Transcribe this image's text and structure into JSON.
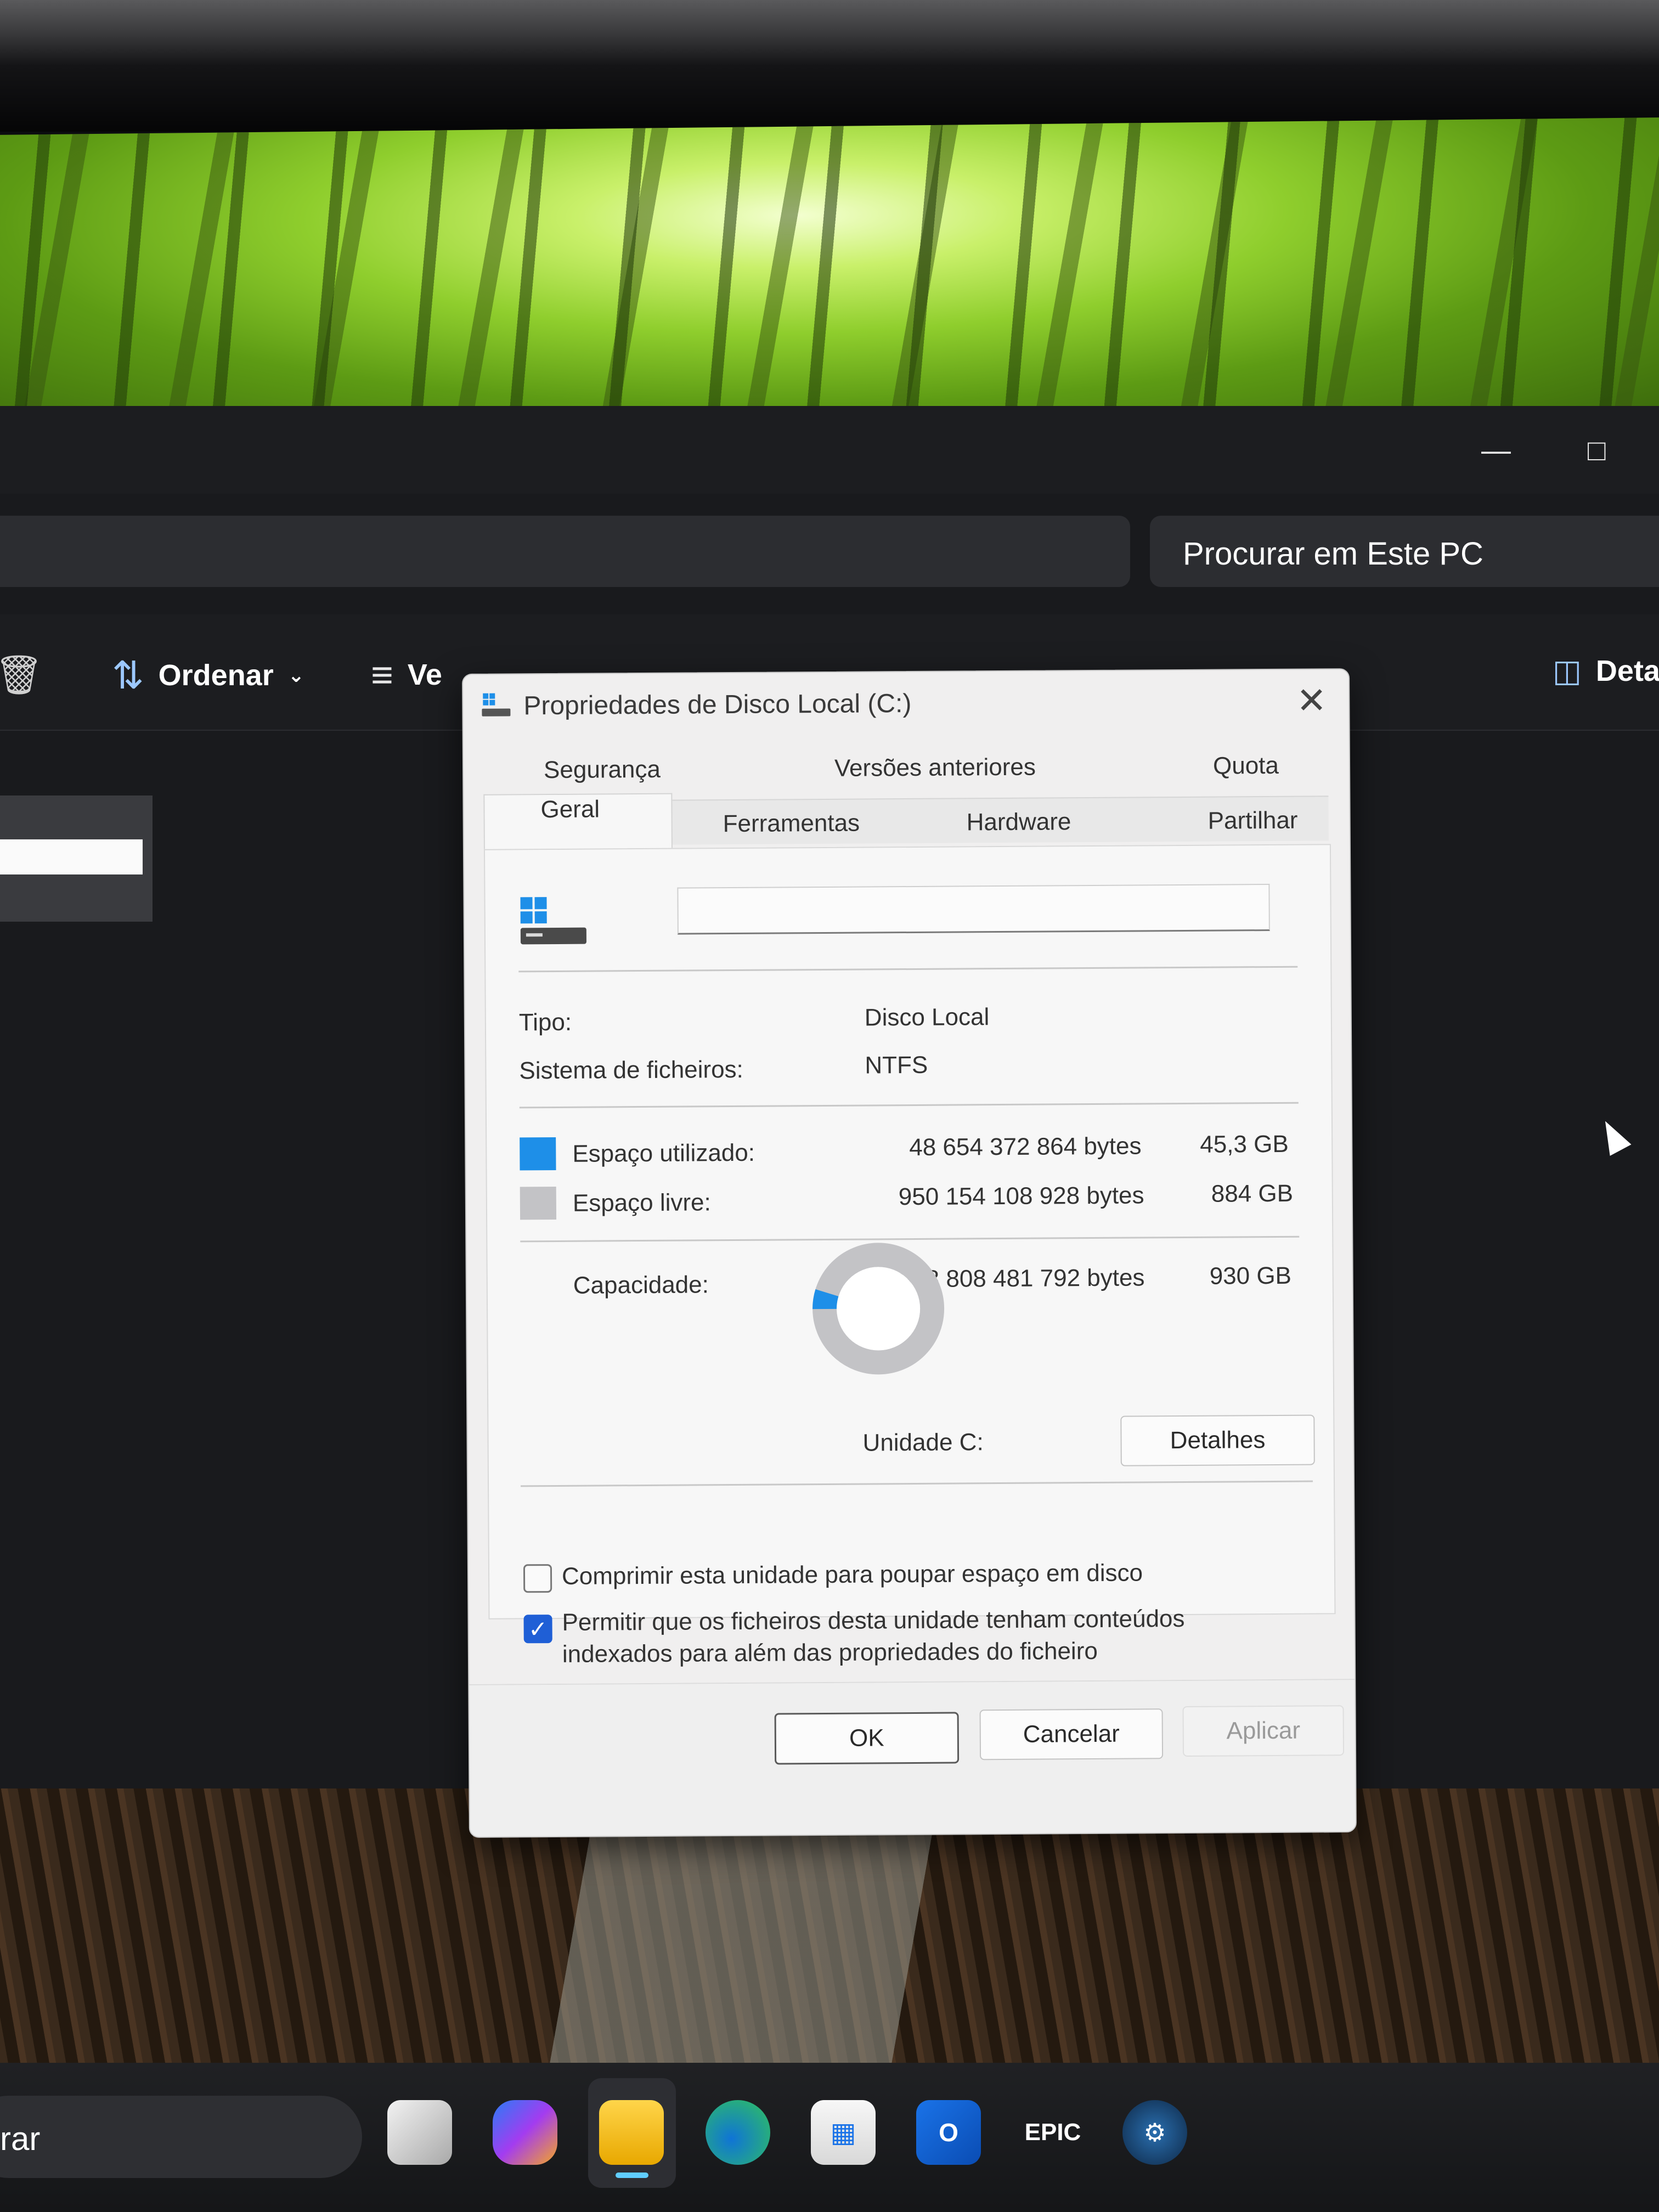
{
  "explorer": {
    "search_placeholder": "Procurar em Este PC",
    "toolbar": {
      "sort_label": "Ordenar",
      "view_label": "Ve",
      "details_label": "Deta"
    }
  },
  "dialog": {
    "title": "Propriedades de Disco Local (C:)",
    "tabs_row1": [
      "Segurança",
      "Versões anteriores",
      "Quota"
    ],
    "tabs_row2": [
      "Geral",
      "Ferramentas",
      "Hardware",
      "Partilhar"
    ],
    "active_tab": "Geral",
    "name_value": "",
    "type_label": "Tipo:",
    "type_value": "Disco Local",
    "fs_label": "Sistema de ficheiros:",
    "fs_value": "NTFS",
    "used_label": "Espaço utilizado:",
    "used_bytes": "48 654 372 864 bytes",
    "used_gb": "45,3 GB",
    "free_label": "Espaço livre:",
    "free_bytes": "950 154 108 928 bytes",
    "free_gb": "884 GB",
    "capacity_label": "Capacidade:",
    "capacity_bytes": "998 808 481 792 bytes",
    "capacity_gb": "930 GB",
    "drive_label": "Unidade C:",
    "details_button": "Detalhes",
    "compress_label": "Comprimir esta unidade para poupar espaço em disco",
    "compress_checked": false,
    "index_label_line1": "Permitir que os ficheiros desta unidade tenham conteúdos",
    "index_label_line2": "indexados para além das propriedades do ficheiro",
    "index_checked": true,
    "ok_button": "OK",
    "cancel_button": "Cancelar",
    "apply_button": "Aplicar",
    "used_color": "#1e8fe8",
    "free_color": "#c3c3c6",
    "used_fraction": 0.0487
  },
  "taskbar": {
    "search_text": "rar",
    "epic_text": "EPIC"
  }
}
